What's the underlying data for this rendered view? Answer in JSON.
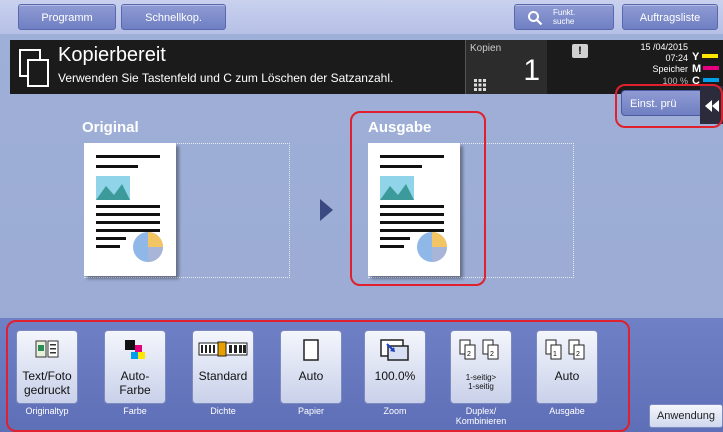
{
  "topbar": {
    "programm": "Programm",
    "schnellkop": "Schnellkop.",
    "funkt_line1": "Funkt.",
    "funkt_line2": "suche",
    "auftragsliste": "Auftragsliste"
  },
  "status": {
    "title": "Kopierbereit",
    "subtitle": "Verwenden Sie Tastenfeld und C zum Löschen der Satzanzahl."
  },
  "kopien": {
    "label": "Kopien",
    "value": "1"
  },
  "info": {
    "date": "15 /04/2015",
    "time": "07:24",
    "memory_label": "Speicher",
    "memory_value": "100 %",
    "toner": [
      "Y",
      "M",
      "C"
    ],
    "toner_colors": [
      "#ffe600",
      "#e4007f",
      "#00a0e9"
    ]
  },
  "einst_button": "Einst. prü",
  "main": {
    "original_label": "Original",
    "ausgabe_label": "Ausgabe"
  },
  "functions": [
    {
      "value": "Text/Foto gedruckt",
      "caption": "Originaltyp",
      "icon": "original-type-icon"
    },
    {
      "value": "Auto-Farbe",
      "caption": "Farbe",
      "icon": "color-icon"
    },
    {
      "value": "Standard",
      "caption": "Dichte",
      "icon": "density-icon"
    },
    {
      "value": "Auto",
      "caption": "Papier",
      "icon": "paper-icon"
    },
    {
      "value": "100.0%",
      "caption": "Zoom",
      "icon": "zoom-icon"
    },
    {
      "value_line1": "1-seitig>",
      "value_line2": "1-seitig",
      "caption_line1": "Duplex/",
      "caption_line2": "Kombinieren",
      "icon": "duplex-icon"
    },
    {
      "value": "Auto",
      "caption": "Ausgabe",
      "icon": "output-icon"
    }
  ],
  "anwendung": "Anwendung",
  "colors": {
    "highlight": "#e0202c",
    "accent": "#6f7fc2"
  }
}
